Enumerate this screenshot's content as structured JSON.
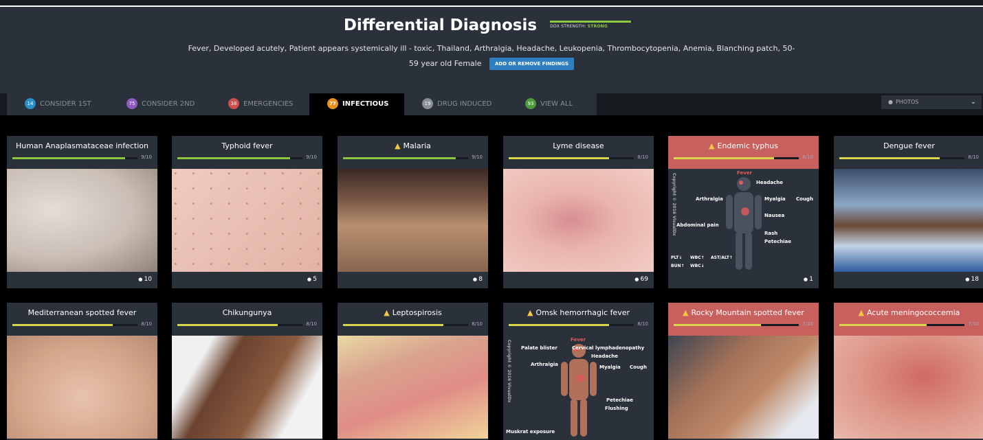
{
  "header": {
    "title": "Differential Diagnosis",
    "strength_label": "DDX STRENGTH:",
    "strength_value": "STRONG",
    "findings_line1": "Fever, Developed acutely, Patient appears systemically ill - toxic, Thailand, Arthralgia, Headache, Leukopenia, Thrombocytopenia, Anemia, Blanching patch, 50-",
    "findings_line2": "59 year old Female",
    "add_button": "ADD OR REMOVE FINDINGS"
  },
  "tabs": [
    {
      "badge": "14",
      "label": "CONSIDER 1ST",
      "color": "#2a8fc7"
    },
    {
      "badge": "75",
      "label": "CONSIDER 2ND",
      "color": "#8e5bbf"
    },
    {
      "badge": "38",
      "label": "EMERGENCIES",
      "color": "#d0504a"
    },
    {
      "badge": "77",
      "label": "INFECTIOUS",
      "color": "#e8921f"
    },
    {
      "badge": "19",
      "label": "DRUG INDUCED",
      "color": "#8a8f96"
    },
    {
      "badge": "93",
      "label": "VIEW ALL",
      "color": "#4e9a3a"
    }
  ],
  "view_select": "PHOTOS",
  "colors": {
    "green": "#8cc63f",
    "yellow": "#d8d64a",
    "red_head": "#c8605d"
  },
  "cards": [
    {
      "title": "Human Anaplasmataceae infection",
      "score": "9/10",
      "fraction": 0.9,
      "warn": false,
      "red": false,
      "photos": "10"
    },
    {
      "title": "Typhoid fever",
      "score": "9/10",
      "fraction": 0.9,
      "warn": false,
      "red": false,
      "photos": "5"
    },
    {
      "title": "Malaria",
      "score": "9/10",
      "fraction": 0.9,
      "warn": true,
      "red": false,
      "photos": "8"
    },
    {
      "title": "Lyme disease",
      "score": "8/10",
      "fraction": 0.8,
      "warn": false,
      "red": false,
      "photos": "69"
    },
    {
      "title": "Endemic typhus",
      "score": "8/10",
      "fraction": 0.8,
      "warn": true,
      "red": true,
      "photos": "1"
    },
    {
      "title": "Dengue fever",
      "score": "8/10",
      "fraction": 0.8,
      "warn": false,
      "red": false,
      "photos": "18"
    },
    {
      "title": "Mediterranean spotted fever",
      "score": "8/10",
      "fraction": 0.8,
      "warn": false,
      "red": false
    },
    {
      "title": "Chikungunya",
      "score": "8/10",
      "fraction": 0.8,
      "warn": false,
      "red": false
    },
    {
      "title": "Leptospirosis",
      "score": "8/10",
      "fraction": 0.8,
      "warn": true,
      "red": false
    },
    {
      "title": "Omsk hemorrhagic fever",
      "score": "8/10",
      "fraction": 0.8,
      "warn": true,
      "red": false
    },
    {
      "title": "Rocky Mountain spotted fever",
      "score": "7/10",
      "fraction": 0.7,
      "warn": true,
      "red": true
    },
    {
      "title": "Acute meningococcemia",
      "score": "7/10",
      "fraction": 0.7,
      "warn": true,
      "red": true
    }
  ],
  "diagram_typhus": {
    "labels": [
      "Fever",
      "Headache",
      "Arthralgia",
      "Myalgia",
      "Cough",
      "Nausea",
      "Abdominal pain",
      "Rash",
      "Petechiae"
    ],
    "labs": [
      "PLT↓",
      "WBC↑",
      "AST/ALT↑",
      "BUN↑",
      "WBC↓"
    ],
    "copyright": "Copyright © 2016 VisualDx"
  },
  "diagram_omsk": {
    "labels": [
      "Fever",
      "Palate blister",
      "Cervical lymphadenopathy",
      "Headache",
      "Arthralgia",
      "Myalgia",
      "Cough",
      "Petechiae",
      "Flushing"
    ],
    "exposure": "Muskrat exposure",
    "copyright": "Copyright © 2016 VisualDx"
  }
}
